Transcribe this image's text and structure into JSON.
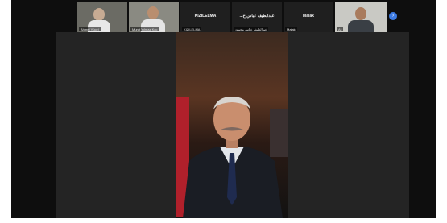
{
  "participants": [
    {
      "name": "Ahmet Yücel",
      "tile_type": "video"
    },
    {
      "name": "Murat Yılmaz Koç",
      "tile_type": "video"
    },
    {
      "name": "KIZILELMA",
      "tile_type": "name",
      "sub_label": "KIZILELMA"
    },
    {
      "name": "...عبدالطيف عباس ح",
      "tile_type": "name",
      "sub_label": "عبدالطيف عباس محمود"
    },
    {
      "name": "Malak",
      "tile_type": "name",
      "sub_label": "Malak"
    },
    {
      "name": "Ali",
      "tile_type": "video"
    }
  ],
  "main_speaker": {
    "name": "عبدالطيف عباس محمود"
  },
  "controls": {
    "expand_icon": "chevron-right-icon",
    "expand_glyph": "›"
  },
  "colors": {
    "background": "#0e0e0e",
    "side_panels": "#242424",
    "accent": "#3d7be3"
  }
}
